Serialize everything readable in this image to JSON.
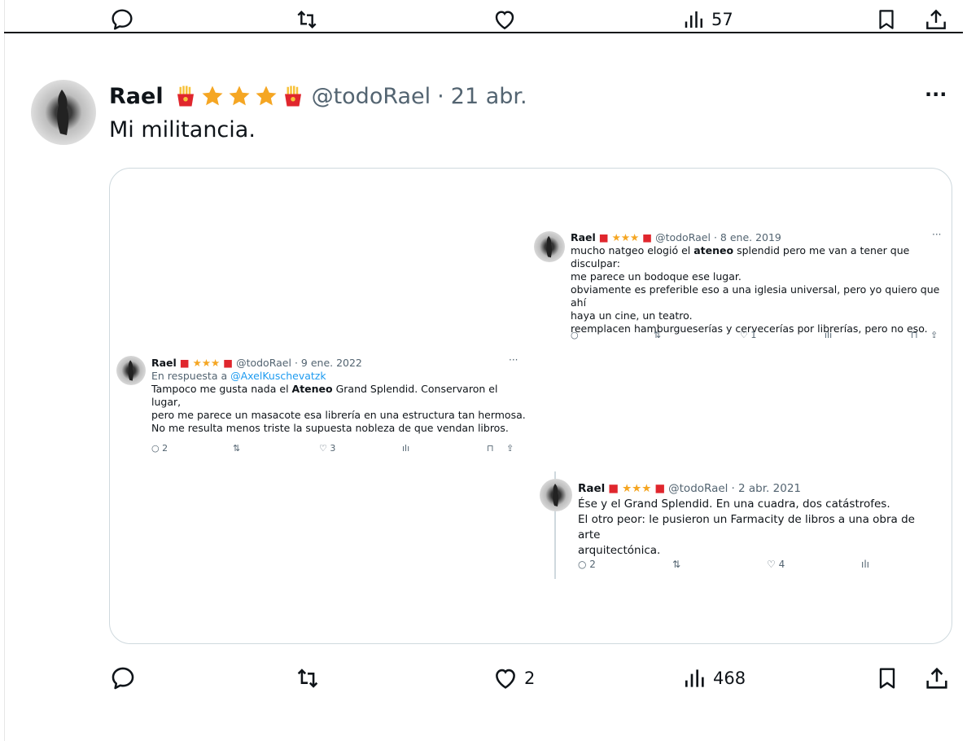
{
  "prev_tweet_actions": {
    "views": "57"
  },
  "tweet": {
    "name": "Rael",
    "handle": "@todoRael",
    "sep": "·",
    "date": "21 abr.",
    "more": "···",
    "text": "Mi militancia.",
    "actions": {
      "likes": "2",
      "views": "468"
    }
  },
  "embedded": {
    "tweet_2019": {
      "name": "Rael",
      "handle": "@todoRael",
      "date": "· 8 ene. 2019",
      "more": "···",
      "line1_pre": "mucho natgeo elogió el ",
      "line1_bold": "ateneo",
      "line1_post": " splendid pero me van a tener que disculpar:",
      "line2": "me parece un bodoque ese lugar.",
      "line3": "obviamente es preferible eso a una iglesia universal, pero yo quiero que ahí",
      "line4": "haya un cine, un teatro.",
      "line5": "reemplacen hamburgueserías y cervecerías por librerías, pero no eso.",
      "likes": "1"
    },
    "tweet_2022": {
      "name": "Rael",
      "handle": "@todoRael",
      "date": "· 9 ene. 2022",
      "more": "···",
      "reply_prefix": "En respuesta a ",
      "reply_to": "@AxelKuschevatzk",
      "line1_pre": "Tampoco me gusta nada el ",
      "line1_bold": "Ateneo",
      "line1_post": " Grand Splendid. Conservaron el lugar,",
      "line2": "pero me parece un masacote esa librería en una estructura tan hermosa.",
      "line3": "No me resulta menos triste la supuesta nobleza de que vendan libros.",
      "replies": "2",
      "likes": "3"
    },
    "tweet_2021": {
      "name": "Rael",
      "handle": "@todoRael",
      "date": "· 2 abr. 2021",
      "line1": "Ése y el Grand Splendid. En una cuadra, dos catástrofes.",
      "line2": "El otro peor: le pusieron un Farmacity de libros a una obra de arte",
      "line3": "arquitectónica.",
      "replies": "2",
      "likes": "4"
    }
  }
}
